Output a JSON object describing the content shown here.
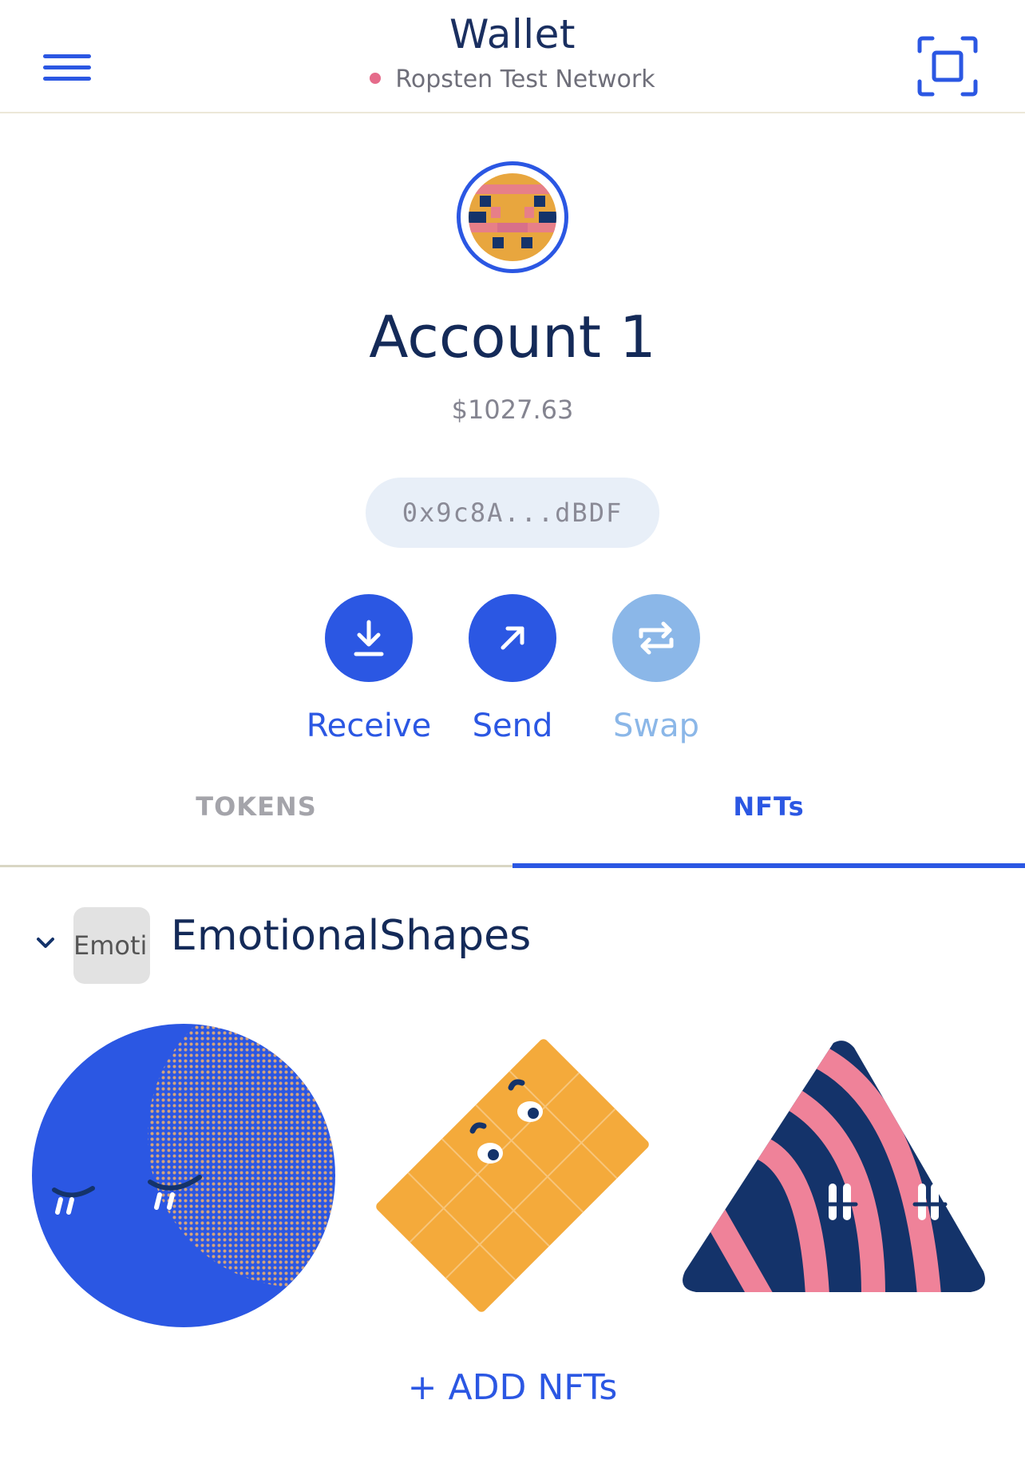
{
  "header": {
    "title": "Wallet",
    "network": "Ropsten Test Network",
    "menu_icon": "hamburger-menu-icon",
    "scan_icon": "qr-scan-icon",
    "network_dot_color": "#e56b8a"
  },
  "account": {
    "name": "Account 1",
    "balance": "$1027.63",
    "address": "0x9c8A...dBDF"
  },
  "actions": [
    {
      "label": "Receive",
      "icon": "download-icon",
      "enabled": true
    },
    {
      "label": "Send",
      "icon": "arrow-up-right-icon",
      "enabled": true
    },
    {
      "label": "Swap",
      "icon": "swap-icon",
      "enabled": false
    }
  ],
  "tabs": [
    {
      "label": "TOKENS",
      "active": false
    },
    {
      "label": "NFTs",
      "active": true
    }
  ],
  "nfts": {
    "collection_name": "EmotionalShapes",
    "collection_thumb_text": "Emoti",
    "items": [
      {
        "shape": "circle"
      },
      {
        "shape": "rectangle"
      },
      {
        "shape": "triangle"
      }
    ],
    "add_label": "+ ADD NFTs"
  },
  "colors": {
    "accent": "#2b57e3",
    "accent_light": "#8bb7e8",
    "text_dark": "#142a58",
    "pink": "#ef8299",
    "orange": "#f4aa3b",
    "navy": "#14336a"
  }
}
